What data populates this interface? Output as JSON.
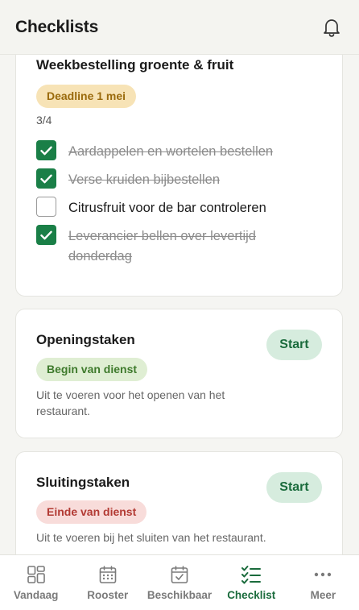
{
  "header": {
    "title": "Checklists",
    "bell_icon": "bell-icon"
  },
  "cards": [
    {
      "title": "Weekbestelling groente & fruit",
      "chip": "Deadline 1 mei",
      "progress": "3/4",
      "items": [
        {
          "label": "Aardappelen en wortelen bestellen",
          "done": true
        },
        {
          "label": "Verse kruiden bijbestellen",
          "done": true
        },
        {
          "label": "Citrusfruit voor de bar controleren",
          "done": false
        },
        {
          "label": "Leverancier bellen over levertijd donderdag",
          "done": true
        }
      ]
    },
    {
      "title": "Openingstaken",
      "chip": "Begin van dienst",
      "description": "Uit te voeren voor het openen van het restaurant.",
      "start_label": "Start"
    },
    {
      "title": "Sluitingstaken",
      "chip": "Einde van dienst",
      "description": "Uit te voeren bij het sluiten van het restaurant.",
      "start_label": "Start"
    }
  ],
  "nav": {
    "items": [
      {
        "label": "Vandaag",
        "icon": "grid-icon"
      },
      {
        "label": "Rooster",
        "icon": "calendar-icon"
      },
      {
        "label": "Beschikbaar",
        "icon": "calendar-check-icon"
      },
      {
        "label": "Checklist",
        "icon": "checklist-icon",
        "active": true
      },
      {
        "label": "Meer",
        "icon": "more-dots-icon"
      }
    ]
  },
  "colors": {
    "accent": "#1a7f47",
    "amber_chip": "#f7e3b6",
    "green_chip": "#dfeed3",
    "red_chip": "#f8dcda"
  }
}
